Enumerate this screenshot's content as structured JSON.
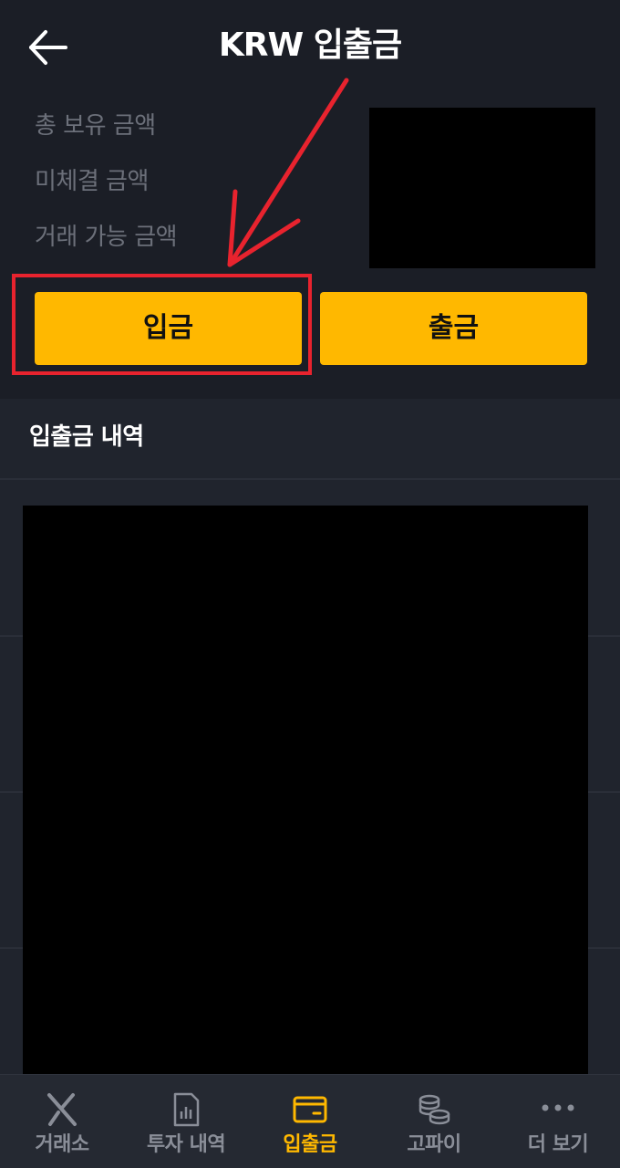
{
  "header": {
    "title": "KRW 입출금",
    "back_icon": "arrow-left-icon"
  },
  "balance": {
    "labels": [
      "총 보유 금액",
      "미체결 금액",
      "거래 가능 금액"
    ]
  },
  "actions": {
    "deposit_label": "입금",
    "withdraw_label": "출금"
  },
  "history": {
    "title": "입출금 내역"
  },
  "tabs": [
    {
      "label": "거래소",
      "icon": "exchange-x-icon",
      "active": false
    },
    {
      "label": "투자 내역",
      "icon": "report-chart-icon",
      "active": false
    },
    {
      "label": "입출금",
      "icon": "wallet-icon",
      "active": true
    },
    {
      "label": "고파이",
      "icon": "coins-stack-icon",
      "active": false
    },
    {
      "label": "더 보기",
      "icon": "more-dots-icon",
      "active": false
    }
  ],
  "colors": {
    "background": "#1b1e26",
    "section": "#20242d",
    "accent": "#ffb800",
    "annotation": "#e8232e",
    "label_muted": "#6c707a"
  }
}
